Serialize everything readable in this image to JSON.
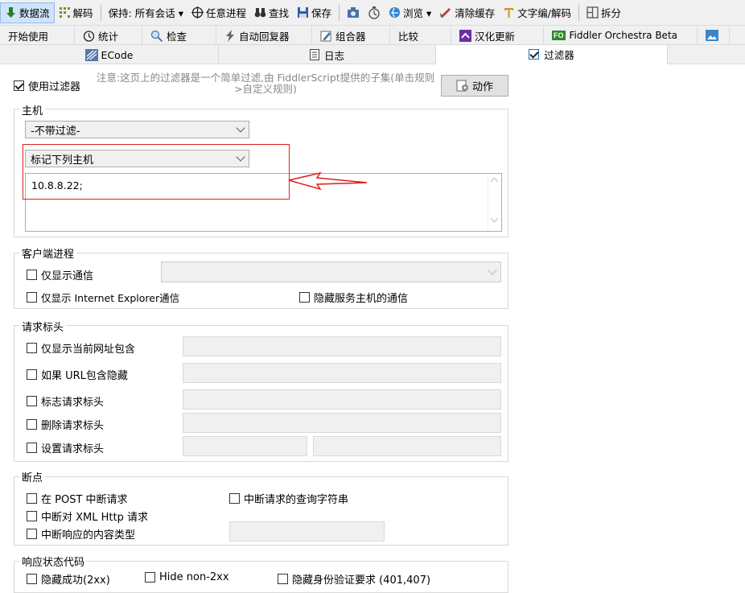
{
  "toolbar": {
    "items": [
      {
        "label": "数据流",
        "icon": "stream-arrow-icon",
        "color": "#2a7d2a"
      },
      {
        "label": "解码",
        "icon": "decode-icon",
        "color": "#7a8c2a"
      },
      {
        "label": "保持: 所有会话 ▾",
        "icon": "",
        "color": ""
      },
      {
        "label": "任意进程",
        "icon": "crosshair-icon",
        "color": "#222"
      },
      {
        "label": "查找",
        "icon": "binoculars-icon",
        "color": "#333"
      },
      {
        "label": "保存",
        "icon": "save-icon",
        "color": "#2f5da8"
      },
      {
        "label": "",
        "icon": "camera-icon",
        "color": "#4a6fa8"
      },
      {
        "label": "",
        "icon": "timer-icon",
        "color": "#555"
      },
      {
        "label": "浏览 ▾",
        "icon": "browser-icon",
        "color": "#2a86d8"
      },
      {
        "label": "清除缓存",
        "icon": "clear-cache-icon",
        "color": "#c23a3a"
      },
      {
        "label": "文字编/解码",
        "icon": "text-encode-icon",
        "color": "#c69a1a"
      },
      {
        "label": "拆分",
        "icon": "split-icon",
        "color": "#555"
      }
    ]
  },
  "tabs_row1": [
    {
      "label": "开始使用",
      "icon": ""
    },
    {
      "label": "统计",
      "icon": "stopwatch-icon"
    },
    {
      "label": "检查",
      "icon": "inspect-icon"
    },
    {
      "label": "自动回复器",
      "icon": "lightning-icon"
    },
    {
      "label": "组合器",
      "icon": "composer-icon"
    },
    {
      "label": "比较",
      "icon": ""
    },
    {
      "label": "汉化更新",
      "icon": "update-icon"
    },
    {
      "label": "Fiddler Orchestra Beta",
      "icon": "fo-icon"
    },
    {
      "label": "",
      "icon": "image-icon"
    }
  ],
  "tabs_row2": [
    {
      "label": "ECode",
      "icon": "ecode-icon"
    },
    {
      "label": "日志",
      "icon": "log-icon"
    },
    {
      "label": "过滤器",
      "icon": "checkbox-icon"
    }
  ],
  "filters": {
    "use_filters_label": "使用过滤器",
    "use_filters_checked": true,
    "hint": "注意:这页上的过滤器是一个简单过滤,由 FiddlerScript提供的子集(单击规则>自定义规则)",
    "actions_label": "动作"
  },
  "host": {
    "legend": "主机",
    "zone_filter": "-不带过滤-",
    "host_filter": "标记下列主机",
    "hosts_text": "10.8.8.22;"
  },
  "client": {
    "legend": "客户端进程",
    "only_traffic_label": "仅显示通信",
    "only_ie_label": "仅显示 Internet Explorer通信",
    "hide_service_label": "隐藏服务主机的通信"
  },
  "request_headers": {
    "legend": "请求标头",
    "items": [
      {
        "label": "仅显示当前网址包含"
      },
      {
        "label": "如果 URL包含隐藏"
      },
      {
        "label": "标志请求标头"
      },
      {
        "label": "删除请求标头"
      },
      {
        "label": "设置请求标头"
      }
    ]
  },
  "breakpoints": {
    "legend": "断点",
    "post_label": "在 POST 中断请求",
    "query_label": "中断请求的查询字符串",
    "xml_label": "中断对 XML Http 请求",
    "content_label": "中断响应的内容类型"
  },
  "status_codes": {
    "legend": "响应状态代码",
    "items": [
      {
        "label": "隐藏成功(2xx)"
      },
      {
        "label": "Hide non-2xx"
      },
      {
        "label": "隐藏身份验证要求 (401,407)"
      }
    ]
  },
  "colors": {
    "annotation_red": "#e02020",
    "selected_tab": "#ffffff",
    "chrome": "#f0f0f0"
  }
}
